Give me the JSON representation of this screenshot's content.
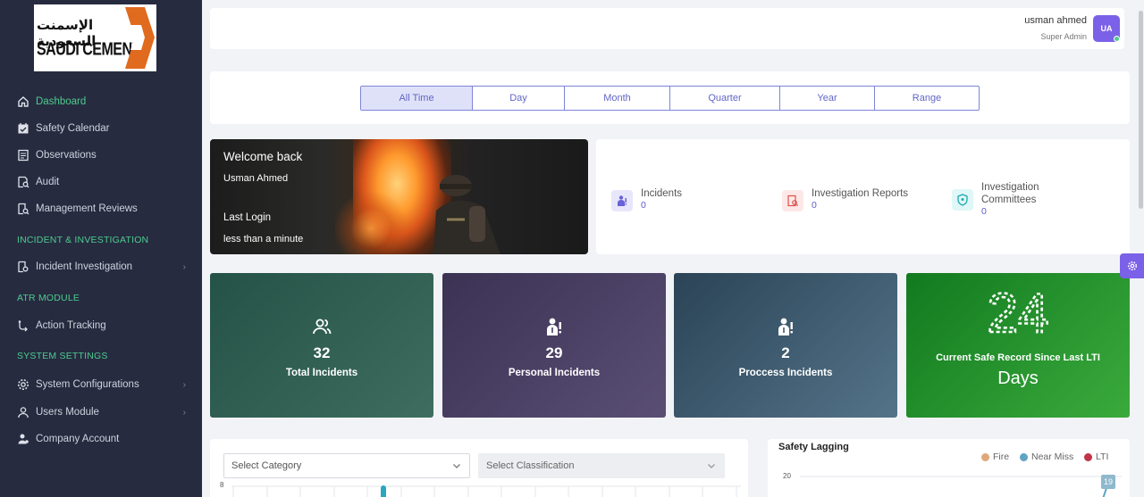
{
  "logo": {
    "arabic": "الإسمنت السعودية",
    "english": "SAUDI CEMENT"
  },
  "sidebar": {
    "items": [
      {
        "label": "Dashboard",
        "icon": "home-icon",
        "active": true
      },
      {
        "label": "Safety Calendar",
        "icon": "calendar-check-icon"
      },
      {
        "label": "Observations",
        "icon": "document-icon"
      },
      {
        "label": "Audit",
        "icon": "audit-icon"
      },
      {
        "label": "Management Reviews",
        "icon": "review-icon"
      }
    ],
    "section_incident": "INCIDENT & INVESTIGATION",
    "incident_item": {
      "label": "Incident Investigation",
      "icon": "investigation-icon"
    },
    "section_atr": "ATR MODULE",
    "atr_item": {
      "label": "Action Tracking",
      "icon": "tracking-icon"
    },
    "section_system": "SYSTEM SETTINGS",
    "system_items": [
      {
        "label": "System Configurations",
        "icon": "gear-icon"
      },
      {
        "label": "Users Module",
        "icon": "user-icon"
      },
      {
        "label": "Company Account",
        "icon": "company-icon"
      }
    ]
  },
  "header": {
    "user_name": "usman ahmed",
    "user_role": "Super Admin",
    "avatar_initials": "UA"
  },
  "period_filter": {
    "options": [
      "All Time",
      "Day",
      "Month",
      "Quarter",
      "Year",
      "Range"
    ],
    "selected": "All Time"
  },
  "welcome": {
    "title": "Welcome back",
    "name": "Usman Ahmed",
    "last_login_label": "Last Login",
    "last_login_value": "less than a minute"
  },
  "summary": [
    {
      "label": "Incidents",
      "value": "0",
      "icon": "person-alert-icon",
      "color": "#e8e6fb"
    },
    {
      "label": "Investigation Reports",
      "value": "0",
      "icon": "report-search-icon",
      "color": "#fde8e8"
    },
    {
      "label": "Investigation Committees",
      "value": "0",
      "icon": "shield-icon",
      "color": "#dff7f7"
    }
  ],
  "stats": [
    {
      "value": "32",
      "label": "Total Incidents",
      "icon": "users-icon"
    },
    {
      "value": "29",
      "label": "Personal Incidents",
      "icon": "person-alert-icon"
    },
    {
      "value": "2",
      "label": "Proccess Incidents",
      "icon": "person-alert-icon"
    }
  ],
  "safe_record": {
    "days_count": "24",
    "label": "Current Safe Record Since Last LTI",
    "unit": "Days"
  },
  "filters": {
    "category_placeholder": "Select Category",
    "classification_placeholder": "Select Classification"
  },
  "chart_data": {
    "type": "bar",
    "title": "Safety Lagging",
    "series": [
      {
        "name": "Fire",
        "color": "#e0a878"
      },
      {
        "name": "Near Miss",
        "color": "#5fa4c2"
      },
      {
        "name": "LTI",
        "color": "#c0344a"
      }
    ],
    "y_tick_visible": "20",
    "data_label_visible": "19"
  },
  "left_chart": {
    "y_tick_visible": "8"
  },
  "colors": {
    "accent": "#5a5fc9",
    "active_nav": "#4ecb8d",
    "sidebar": "#262b40"
  }
}
